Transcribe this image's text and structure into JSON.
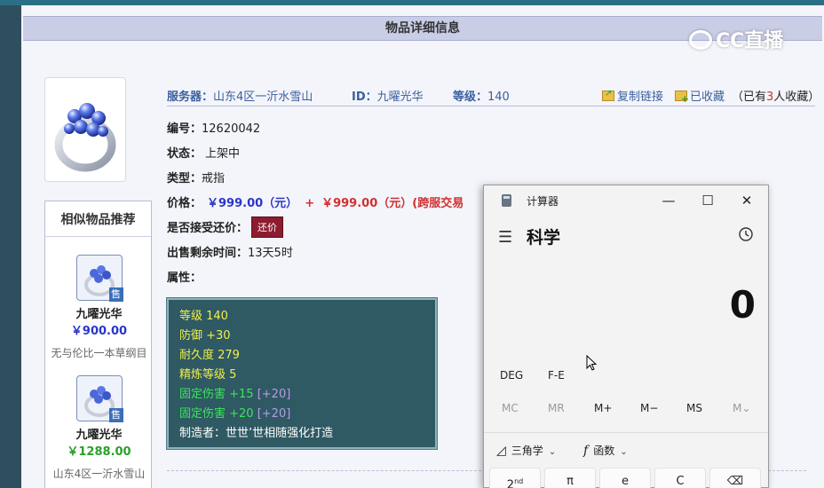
{
  "page": {
    "title": "物品详细信息",
    "watermark": "CC直播"
  },
  "meta": {
    "server_label": "服务器：",
    "server_value": "山东4区一沂水雪山",
    "id_label": "ID：",
    "id_value": "九曜光华",
    "level_label": "等级：",
    "level_value": "140",
    "copy_link": "复制链接",
    "favorited": "已收藏",
    "fav_count_prefix": "（已有",
    "fav_count": "3",
    "fav_count_suffix": "人收藏）"
  },
  "fields": {
    "number_label": "编号：",
    "number_value": "12620042",
    "status_label": "状态：",
    "status_value": "上架中",
    "type_label": "类型：",
    "type_value": "戒指",
    "price_label": "价格：",
    "price_a": "￥999.00（元）",
    "price_plus": "+",
    "price_b": "￥999.00（元）(跨服交易",
    "bargain_label": "是否接受还价：",
    "bargain_button": "还价",
    "remaining_label": "出售剩余时间：",
    "remaining_value": "13天5时",
    "attr_label": "属性："
  },
  "attributes": {
    "level": "等级 140",
    "defense": "防御 +30",
    "durability": "耐久度 279",
    "refine": "精炼等级 5",
    "fixed1": "固定伤害 +15",
    "fixed1_bonus": "[+20]",
    "fixed2": "固定伤害 +20",
    "fixed2_bonus": "[+20]",
    "maker": "制造者：世世’世相随强化打造"
  },
  "similar": {
    "title": "相似物品推荐",
    "badge": "售",
    "items": [
      {
        "name": "九曜光华",
        "price": "￥900.00",
        "sub": "无与伦比一本草纲目",
        "price_color": "#2a36c8"
      },
      {
        "name": "九曜光华",
        "price": "￥1288.00",
        "sub": "山东4区一沂水雪山",
        "price_color": "#2aa02a"
      }
    ]
  },
  "calculator": {
    "app_title": "计算器",
    "minimize": "—",
    "maximize": "☐",
    "close": "✕",
    "menu_icon": "☰",
    "mode": "科学",
    "history_icon": "history-icon",
    "display": "0",
    "deg": "DEG",
    "fe": "F-E",
    "mem": [
      "MC",
      "MR",
      "M+",
      "M−",
      "MS",
      "M⌄"
    ],
    "trig_label": "三角学",
    "func_label": "函数",
    "keys": [
      "2nd",
      "π",
      "e",
      "C",
      "⌫"
    ]
  },
  "colors": {
    "accent_blue": "#3a5fa0",
    "price_blue": "#2a36c8",
    "price_red": "#d03030",
    "attr_bg": "#2f5963"
  }
}
